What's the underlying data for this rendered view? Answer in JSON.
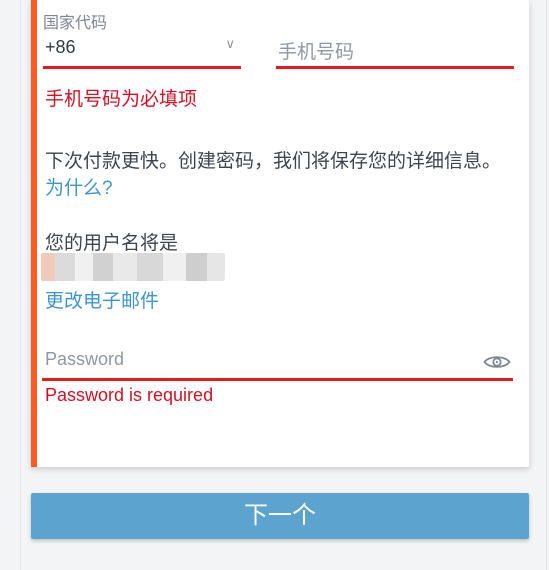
{
  "form": {
    "country_label": "国家代码",
    "country_value": "+86",
    "phone_placeholder": "手机号码",
    "phone_error": "手机号码为必填项",
    "save_info_text": "下次付款更快。创建密码，我们将保存您的详细信息。",
    "why_link": "为什么?",
    "username_label": "您的用户名将是",
    "change_email_link": "更改电子邮件",
    "password_placeholder": "Password",
    "password_error": "Password is required"
  },
  "actions": {
    "next_label": "下一个"
  },
  "icons": {
    "country_dropdown": "chevron-down-icon",
    "show_password": "eye-icon"
  },
  "colors": {
    "accent": "#ff5a1f",
    "error": "#d50f25",
    "link": "#3c95cf",
    "button": "#5ca4cf"
  }
}
